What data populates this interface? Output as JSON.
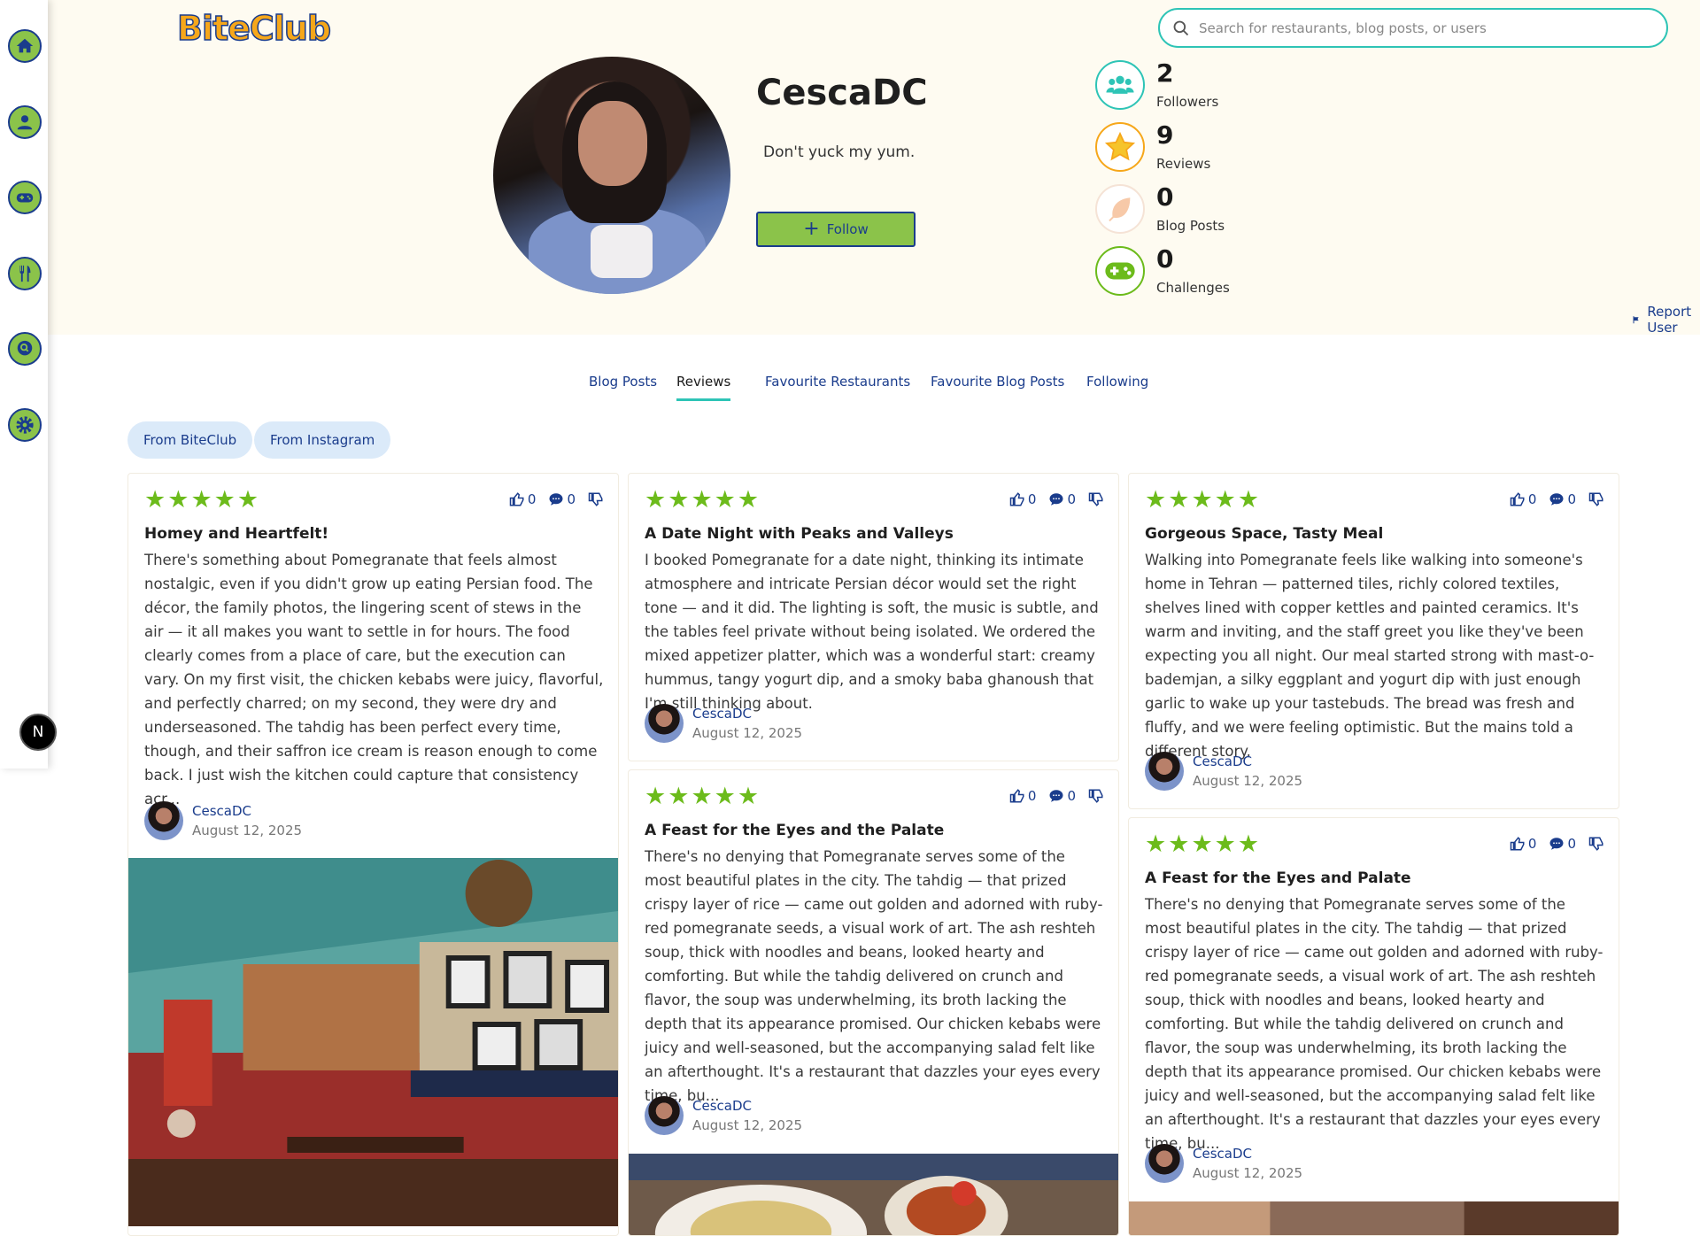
{
  "app": {
    "logo": "BiteClub"
  },
  "search": {
    "placeholder": "Search for restaurants, blog posts, or users"
  },
  "sidebar": {
    "items": [
      "home-icon",
      "profile-icon",
      "gamepad-icon",
      "restaurant-icon",
      "search-bubble-icon",
      "settings-icon"
    ]
  },
  "nav_badge": "N",
  "profile": {
    "username": "CescaDC",
    "bio": "Don't yuck my yum.",
    "follow_label": "Follow",
    "stats": [
      {
        "value": "2",
        "label": "Followers",
        "icon": "users-icon",
        "color": "#2ec4b6"
      },
      {
        "value": "9",
        "label": "Reviews",
        "icon": "star-icon",
        "color": "#f6a71a"
      },
      {
        "value": "0",
        "label": "Blog Posts",
        "icon": "feather-icon",
        "color": "#f7c9a8"
      },
      {
        "value": "0",
        "label": "Challenges",
        "icon": "gamepad-icon",
        "color": "#6cbb1b"
      }
    ],
    "report_label": "Report User"
  },
  "tabs": [
    "Blog Posts",
    "Reviews",
    "Favourite Restaurants",
    "Favourite Blog Posts",
    "Following"
  ],
  "active_tab": "Reviews",
  "filters": [
    "From BiteClub",
    "From Instagram"
  ],
  "colors": {
    "accent": "#1a3c8c",
    "green": "#8bc34a",
    "teal": "#2ec4b6",
    "star": "#6cbb1b",
    "band": "#fefbf1"
  },
  "reviews": [
    {
      "title": "Homey and Heartfelt!",
      "likes": "0",
      "comments": "0",
      "body": "There's something about Pomegranate that feels almost nostalgic, even if you didn't grow up eating Persian food. The décor, the family photos, the lingering scent of stews in the air — it all makes you want to settle in for hours. The food clearly comes from a place of care, but the execution can vary. On my first visit, the chicken kebabs were juicy, flavorful, and perfectly charred; on my second, they were dry and underseasoned. The tahdig has been perfect every time, though, and their saffron ice cream is reason enough to come back. I just wish the kitchen could capture that consistency acr...",
      "author": "CescaDC",
      "date": "August 12, 2025"
    },
    {
      "title": "A Date Night with Peaks and Valleys",
      "likes": "0",
      "comments": "0",
      "body": "I booked Pomegranate for a date night, thinking its intimate atmosphere and intricate Persian décor would set the right tone — and it did. The lighting is soft, the music is subtle, and the tables feel private without being isolated. We ordered the mixed appetizer platter, which was a wonderful start: creamy hummus, tangy yogurt dip, and a smoky baba ghanoush that I'm still thinking about.",
      "author": "CescaDC",
      "date": "August 12, 2025"
    },
    {
      "title": "Gorgeous Space, Tasty Meal",
      "likes": "0",
      "comments": "0",
      "body": "Walking into Pomegranate feels like walking into someone's home in Tehran — patterned tiles, richly colored textiles, shelves lined with copper kettles and painted ceramics. It's warm and inviting, and the staff greet you like they've been expecting you all night. Our meal started strong with mast-o-bademjan, a silky eggplant and yogurt dip with just enough garlic to wake up your tastebuds. The bread was fresh and fluffy, and we were feeling optimistic. But the mains told a different story.",
      "author": "CescaDC",
      "date": "August 12, 2025"
    },
    {
      "title": "A Feast for the Eyes and the Palate",
      "likes": "0",
      "comments": "0",
      "body": "There's no denying that Pomegranate serves some of the most beautiful plates in the city. The tahdig — that prized crispy layer of rice — came out golden and adorned with ruby-red pomegranate seeds, a visual work of art. The ash reshteh soup, thick with noodles and beans, looked hearty and comforting. But while the tahdig delivered on crunch and flavor, the soup was underwhelming, its broth lacking the depth that its appearance promised. Our chicken kebabs were juicy and well-seasoned, but the accompanying salad felt like an afterthought. It's a restaurant that dazzles your eyes every time, bu...",
      "author": "CescaDC",
      "date": "August 12, 2025"
    },
    {
      "title": "A Feast for the Eyes and Palate",
      "likes": "0",
      "comments": "0",
      "body": "There's no denying that Pomegranate serves some of the most beautiful plates in the city. The tahdig — that prized crispy layer of rice — came out golden and adorned with ruby-red pomegranate seeds, a visual work of art. The ash reshteh soup, thick with noodles and beans, looked hearty and comforting. But while the tahdig delivered on crunch and flavor, the soup was underwhelming, its broth lacking the depth that its appearance promised. Our chicken kebabs were juicy and well-seasoned, but the accompanying salad felt like an afterthought. It's a restaurant that dazzles your eyes every time, bu...",
      "author": "CescaDC",
      "date": "August 12, 2025"
    }
  ]
}
